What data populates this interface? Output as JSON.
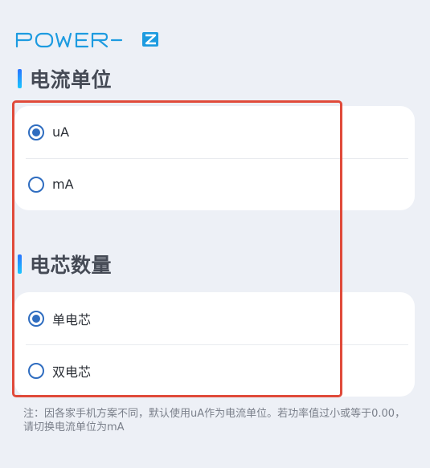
{
  "app": {
    "logo_text": "POWER-Z"
  },
  "sections": {
    "current_unit": {
      "title": "电流单位",
      "options": [
        {
          "label": "uA",
          "selected": true
        },
        {
          "label": "mA",
          "selected": false
        }
      ]
    },
    "cell_count": {
      "title": "电芯数量",
      "options": [
        {
          "label": "单电芯",
          "selected": true
        },
        {
          "label": "双电芯",
          "selected": false
        }
      ]
    }
  },
  "note": "注：因各家手机方案不同，默认使用uA作为电流单位。若功率值过小或等于0.00，请切换电流单位为mA",
  "colors": {
    "accent": "#2f6dc0",
    "background": "#edf0f6",
    "card": "#ffffff",
    "highlight_frame": "#e04a3a",
    "logo": "#1d9be0"
  }
}
